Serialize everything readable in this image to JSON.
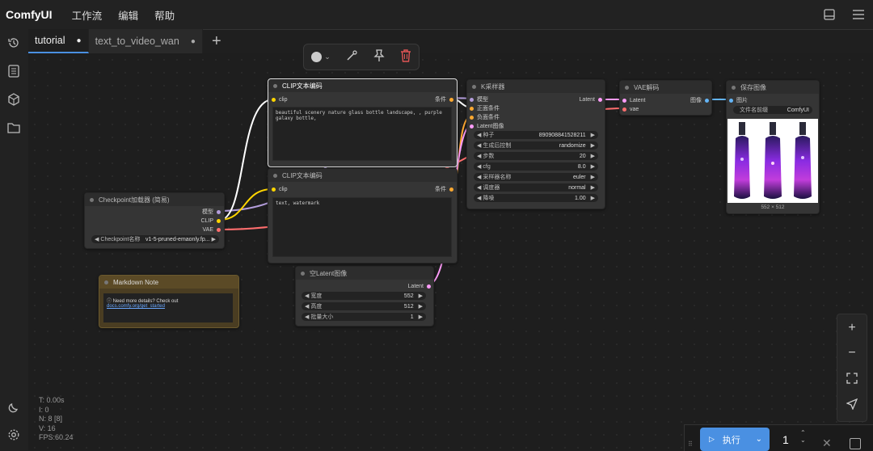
{
  "app": {
    "logo": "ComfyUI"
  },
  "menu": [
    "工作流",
    "编辑",
    "帮助"
  ],
  "tabs": [
    {
      "label": "tutorial",
      "dot": "●"
    },
    {
      "label": "text_to_video_wan",
      "dot": "●"
    }
  ],
  "tab_add": "+",
  "nodes": {
    "clip_pos": {
      "title": "CLIP文本编码",
      "in_clip": "clip",
      "out": "条件",
      "text": "beautiful scenery nature glass bottle landscape, , purple galaxy bottle,"
    },
    "clip_neg": {
      "title": "CLIP文本编码",
      "in_clip": "clip",
      "out": "条件",
      "text": "text, watermark"
    },
    "checkpoint": {
      "title": "Checkpoint加载器 (简易)",
      "out_model": "模型",
      "out_clip": "CLIP",
      "out_vae": "VAE",
      "widget_label": "Checkpoint名称",
      "widget_value": "v1-5-pruned-emaonly.fp..."
    },
    "ksampler": {
      "title": "K采样器",
      "in_model": "模型",
      "in_pos": "正面条件",
      "in_neg": "负面条件",
      "in_latent": "Latent图像",
      "out": "Latent",
      "widgets": [
        {
          "label": "种子",
          "value": "890908841528211"
        },
        {
          "label": "生成后控制",
          "value": "randomize"
        },
        {
          "label": "步数",
          "value": "20"
        },
        {
          "label": "cfg",
          "value": "8.0"
        },
        {
          "label": "采样器名称",
          "value": "euler"
        },
        {
          "label": "调度器",
          "value": "normal"
        },
        {
          "label": "降噪",
          "value": "1.00"
        }
      ]
    },
    "vae": {
      "title": "VAE解码",
      "in_latent": "Latent",
      "in_vae": "vae",
      "out": "图像"
    },
    "save": {
      "title": "保存图像",
      "in": "图片",
      "widget_label": "文件名前缀",
      "widget_value": "ComfyUI",
      "size": "552 × 512"
    },
    "latent": {
      "title": "空Latent图像",
      "out": "Latent",
      "widgets": [
        {
          "label": "宽度",
          "value": "552"
        },
        {
          "label": "高度",
          "value": "512"
        },
        {
          "label": "批量大小",
          "value": "1"
        }
      ]
    },
    "note": {
      "title": "Markdown Note",
      "text_prefix": "ⓘ Need more details? Check out ",
      "link": "docs.comfy.org/get_started"
    }
  },
  "stats": {
    "t": "T: 0.00s",
    "i": "I: 0",
    "n": "N: 8 [8]",
    "v": "V: 16",
    "fps": "FPS:60.24"
  },
  "run": {
    "label": "执行",
    "count": "1"
  },
  "colors": {
    "accent": "#4a90e2",
    "delete": "#e05555",
    "link_model": "#b39ddb",
    "link_clip": "#ffd500",
    "link_vae": "#ff6e6e",
    "link_latent": "#ff9cf9",
    "link_cond": "#ffa931",
    "link_image": "#64b5f6"
  }
}
